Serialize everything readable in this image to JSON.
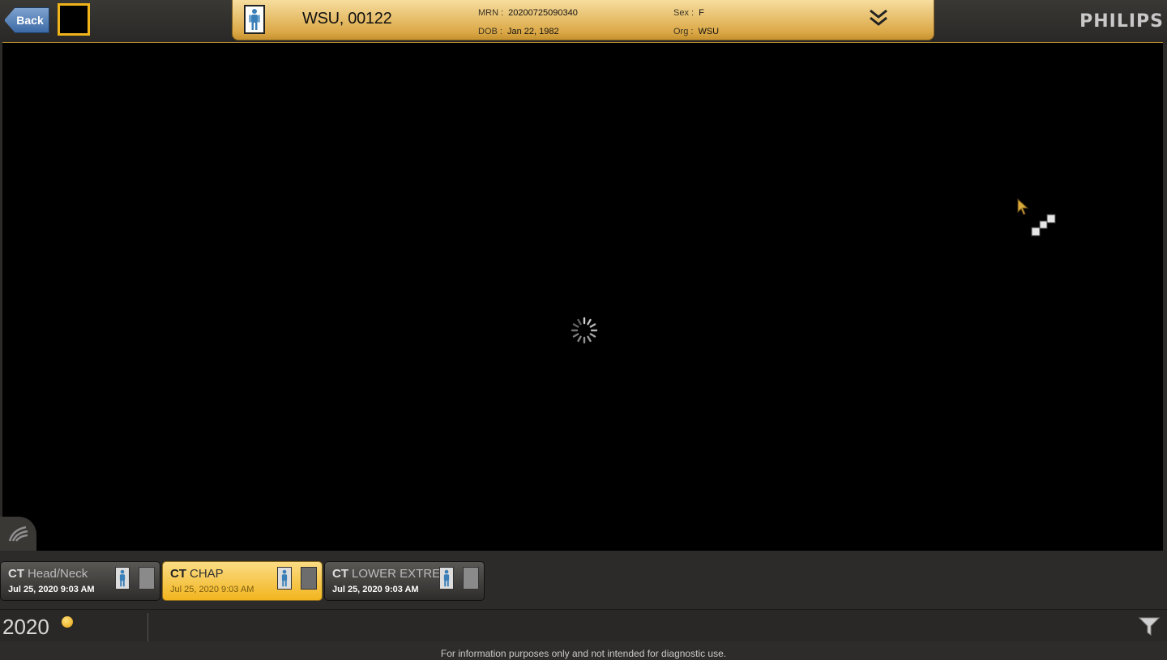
{
  "topbar": {
    "back_label": "Back",
    "brand": "PHILIPS"
  },
  "patient": {
    "name": "WSU, 00122",
    "mrn_label": "MRN :",
    "mrn": "20200725090340",
    "dob_label": "DOB :",
    "dob": "Jan 22, 1982",
    "sex_label": "Sex :",
    "sex": "F",
    "org_label": "Org :",
    "org": "WSU"
  },
  "studies": [
    {
      "modality": "CT",
      "description": "Head/Neck",
      "date": "Jul 25, 2020 9:03 AM",
      "active": false
    },
    {
      "modality": "CT",
      "description": "CHAP",
      "date": "Jul 25, 2020 9:03 AM",
      "active": true
    },
    {
      "modality": "CT",
      "description": "LOWER EXTREMI",
      "date": "Jul 25, 2020 9:03 AM",
      "active": false
    }
  ],
  "timeline": {
    "year": "2020"
  },
  "footer": {
    "disclaimer": "For information purposes only and not intended for diagnostic use."
  },
  "colors": {
    "accent": "#f2b51e",
    "banner": "#dca948",
    "back_button": "#3d6aa6"
  },
  "icons": [
    "person-icon",
    "document-icon",
    "chevron-double-down-icon",
    "filter-icon",
    "loading-spinner-icon",
    "layout-icon"
  ]
}
